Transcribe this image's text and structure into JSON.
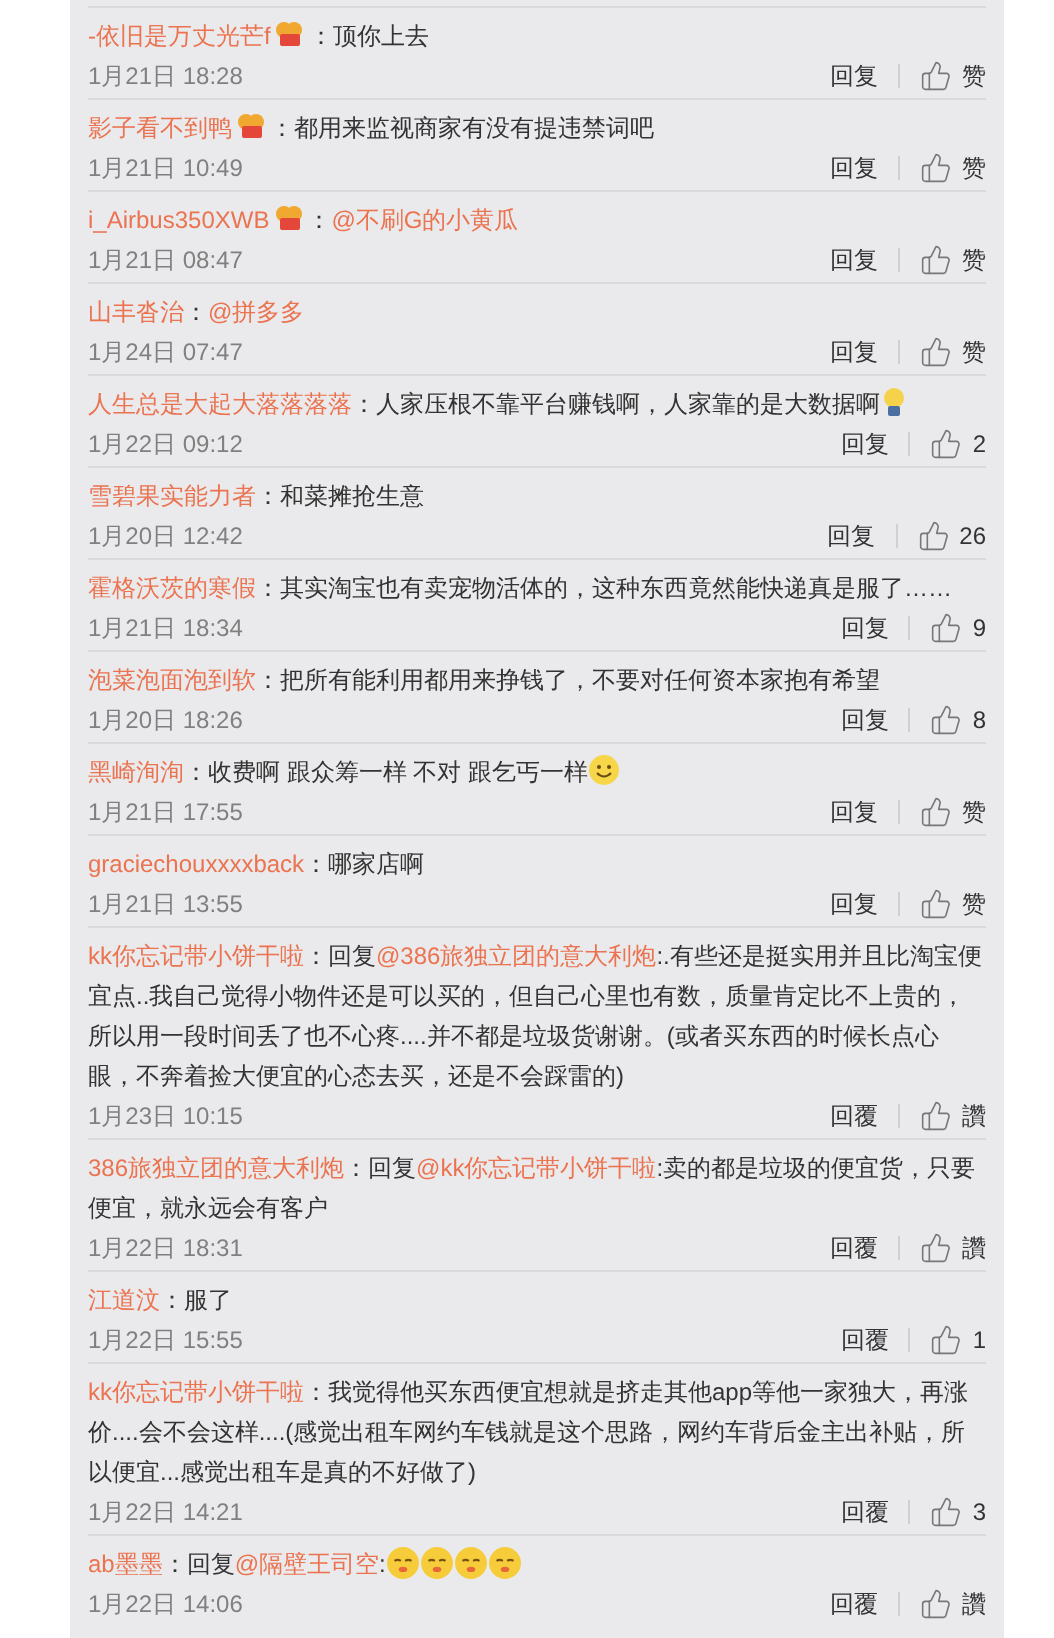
{
  "comments": [
    {
      "user": "-依旧是万丈光芒f",
      "badge": true,
      "segments": [
        {
          "kind": "text",
          "text": "：顶你上去"
        }
      ],
      "time": "1月21日 18:28",
      "reply": "回复",
      "like": "赞"
    },
    {
      "user": "影子看不到鸭",
      "badge": true,
      "segments": [
        {
          "kind": "text",
          "text": "：都用来监视商家有没有提违禁词吧"
        }
      ],
      "time": "1月21日 10:49",
      "reply": "回复",
      "like": "赞"
    },
    {
      "user": "i_Airbus350XWB",
      "badge": true,
      "segments": [
        {
          "kind": "text",
          "text": "："
        },
        {
          "kind": "mention",
          "text": "@不刷G的小黄瓜"
        }
      ],
      "time": "1月21日 08:47",
      "reply": "回复",
      "like": "赞"
    },
    {
      "user": "山丰沓治",
      "badge": false,
      "segments": [
        {
          "kind": "text",
          "text": "："
        },
        {
          "kind": "mention",
          "text": "@拼多多"
        }
      ],
      "time": "1月24日 07:47",
      "reply": "回复",
      "like": "赞"
    },
    {
      "user": "人生总是大起大落落落落",
      "badge": false,
      "segments": [
        {
          "kind": "text",
          "text": "：人家压根不靠平台赚钱啊，人家靠的是大数据啊"
        }
      ],
      "emojis": [
        {
          "kind": "bulb"
        }
      ],
      "time": "1月22日 09:12",
      "reply": "回复",
      "like": "2"
    },
    {
      "user": "雪碧果实能力者",
      "badge": false,
      "segments": [
        {
          "kind": "text",
          "text": "：和菜摊抢生意"
        }
      ],
      "time": "1月20日 12:42",
      "reply": "回复",
      "like": "26"
    },
    {
      "user": "霍格沃茨的寒假",
      "badge": false,
      "segments": [
        {
          "kind": "text",
          "text": "：其实淘宝也有卖宠物活体的，这种东西竟然能快递真是服了……"
        }
      ],
      "time": "1月21日 18:34",
      "reply": "回复",
      "like": "9"
    },
    {
      "user": "泡菜泡面泡到软",
      "badge": false,
      "segments": [
        {
          "kind": "text",
          "text": "：把所有能利用都用来挣钱了，不要对任何资本家抱有希望"
        }
      ],
      "time": "1月20日 18:26",
      "reply": "回复",
      "like": "8"
    },
    {
      "user": "黑崎洵洵",
      "badge": false,
      "segments": [
        {
          "kind": "text",
          "text": "：收费啊 跟众筹一样 不对 跟乞丐一样"
        }
      ],
      "emojis": [
        {
          "kind": "smile"
        }
      ],
      "time": "1月21日 17:55",
      "reply": "回复",
      "like": "赞"
    },
    {
      "user": "graciechouxxxxback",
      "badge": false,
      "segments": [
        {
          "kind": "text",
          "text": "：哪家店啊"
        }
      ],
      "time": "1月21日 13:55",
      "reply": "回复",
      "like": "赞"
    },
    {
      "user": "kk你忘记带小饼干啦",
      "badge": false,
      "segments": [
        {
          "kind": "text",
          "text": "：回复"
        },
        {
          "kind": "mention",
          "text": "@386旅独立团的意大利炮"
        },
        {
          "kind": "text",
          "text": ":.有些还是挺实用并且比淘宝便宜点..我自己觉得小物件还是可以买的，但自己心里也有数，质量肯定比不上贵的，所以用一段时间丢了也不心疼....并不都是垃圾货谢谢。(或者买东西的时候长点心眼，不奔着捡大便宜的心态去买，还是不会踩雷的)"
        }
      ],
      "time": "1月23日 10:15",
      "reply": "回覆",
      "like": "讚"
    },
    {
      "user": "386旅独立团的意大利炮",
      "badge": false,
      "segments": [
        {
          "kind": "text",
          "text": "：回复"
        },
        {
          "kind": "mention",
          "text": "@kk你忘记带小饼干啦"
        },
        {
          "kind": "text",
          "text": ":卖的都是垃圾的便宜货，只要便宜，就永远会有客户"
        }
      ],
      "time": "1月22日 18:31",
      "reply": "回覆",
      "like": "讚"
    },
    {
      "user": "江道汶",
      "badge": false,
      "segments": [
        {
          "kind": "text",
          "text": "：服了"
        }
      ],
      "time": "1月22日 15:55",
      "reply": "回覆",
      "like": "1"
    },
    {
      "user": "kk你忘记带小饼干啦",
      "badge": false,
      "segments": [
        {
          "kind": "text",
          "text": "：我觉得他买东西便宜想就是挤走其他app等他一家独大，再涨价....会不会这样....(感觉出租车网约车钱就是这个思路，网约车背后金主出补贴，所以便宜...感觉出租车是真的不好做了)"
        }
      ],
      "time": "1月22日 14:21",
      "reply": "回覆",
      "like": "3"
    },
    {
      "user": "ab墨墨",
      "badge": false,
      "segments": [
        {
          "kind": "text",
          "text": "：回复"
        },
        {
          "kind": "mention",
          "text": "@隔壁王司空"
        },
        {
          "kind": "text",
          "text": ":"
        }
      ],
      "emojis": [
        {
          "kind": "grin"
        },
        {
          "kind": "grin"
        },
        {
          "kind": "grin"
        },
        {
          "kind": "grin"
        }
      ],
      "time": "1月22日 14:06",
      "reply": "回覆",
      "like": "讚"
    }
  ]
}
